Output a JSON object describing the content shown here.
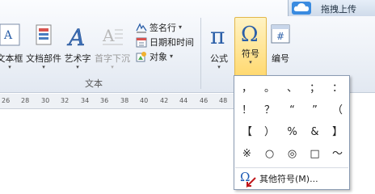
{
  "upload": {
    "label": "拖拽上传"
  },
  "ribbon": {
    "buttons": [
      {
        "label": "文本框"
      },
      {
        "label": "文档部件"
      },
      {
        "label": "艺术字"
      },
      {
        "label": "首字下沉"
      }
    ],
    "small": [
      {
        "label": "签名行",
        "arrow": "▾"
      },
      {
        "label": "日期和时间"
      },
      {
        "label": "对象",
        "arrow": "▾"
      }
    ],
    "text_group_label": "文本",
    "formula_label": "公式",
    "symbol_label": "符号",
    "number_label": "编号"
  },
  "ruler": {
    "ticks": [
      "26",
      "28",
      "30",
      "32",
      "34",
      "36",
      "38",
      "40",
      "42",
      "44",
      "46",
      "48"
    ]
  },
  "symbols": {
    "grid": [
      [
        "，",
        "。",
        "、",
        "；",
        "："
      ],
      [
        "！",
        "？",
        "“",
        "”",
        "（"
      ],
      [
        "【",
        "）",
        "%",
        "&",
        "】"
      ],
      [
        "※",
        "○",
        "◎",
        "□",
        "～"
      ]
    ],
    "more_label": "其他符号(M)..."
  }
}
